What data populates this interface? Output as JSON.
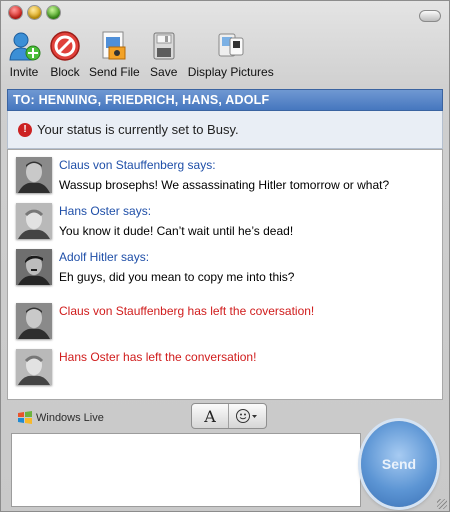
{
  "toolbar": {
    "invite": "Invite",
    "block": "Block",
    "send_file": "Send File",
    "save": "Save",
    "display_pictures": "Display Pictures"
  },
  "to_bar": "TO: HENNING, FRIEDRICH, HANS, ADOLF",
  "status": "Your status is currently set to Busy.",
  "messages": [
    {
      "name": "Claus von Stauffenberg says:",
      "text": "Wassup brosephs! We assassinating Hitler tomorrow or what?"
    },
    {
      "name": "Hans Oster says:",
      "text": "You know it dude! Can’t wait until he’s dead!"
    },
    {
      "name": "Adolf Hitler says:",
      "text": "Eh guys, did you mean to copy me into this?"
    }
  ],
  "events": [
    "Claus von Stauffenberg has left the coversation!",
    "Hans Oster has left the conversation!"
  ],
  "logo": "Windows Live",
  "format_font_glyph": "A",
  "send": "Send",
  "colors": {
    "accent": "#4677bf",
    "left_text": "#d01c1c",
    "name_text": "#1f4fa8"
  }
}
